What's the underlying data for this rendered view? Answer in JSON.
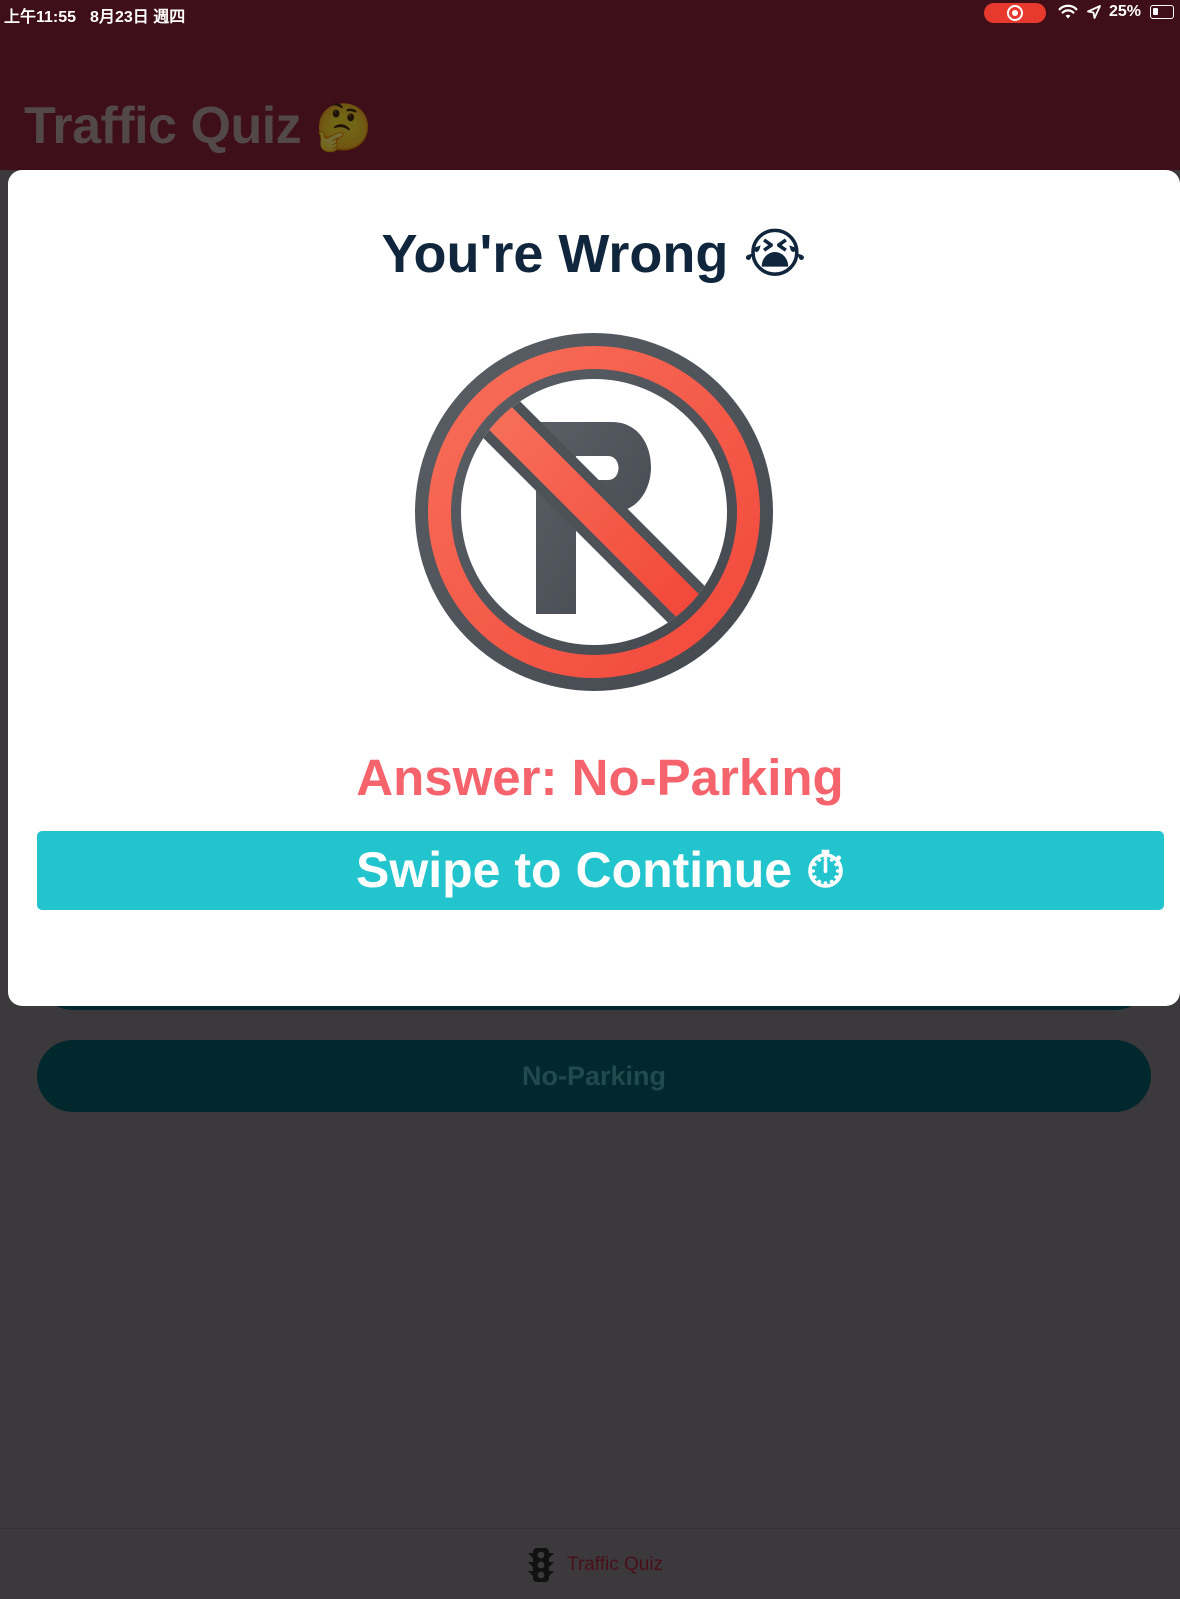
{
  "status_bar": {
    "time": "上午11:55",
    "date": "8月23日 週四",
    "battery": "25%"
  },
  "header": {
    "title": "Traffic Quiz",
    "title_emoji": "🤔"
  },
  "options": {
    "visible_option": "No-Parking"
  },
  "modal": {
    "title": "You're Wrong",
    "title_emoji": "😭",
    "sign_icon": "no-parking-sign-icon",
    "answer_label": "Answer: No-Parking",
    "continue_label": "Swipe to Continue",
    "continue_emoji": "⏱"
  },
  "tab_bar": {
    "active_tab_label": "Traffic Quiz",
    "active_tab_icon": "traffic-light-icon"
  },
  "colors": {
    "header_bg": "#3e0f18",
    "overlay_bg": "#3b393c",
    "title_navy": "#10263d",
    "answer_red": "#f5636c",
    "button_teal": "#22c4cd",
    "option_bg": "#00282d",
    "sign_red": "#f35c44",
    "sign_gray": "#4d5259"
  }
}
